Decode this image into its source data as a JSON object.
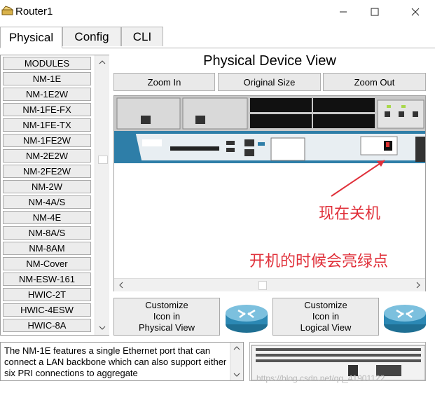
{
  "window": {
    "title": "Router1",
    "controls": {
      "minimize": "—",
      "maximize": "☐",
      "close": "✕"
    }
  },
  "tabs": [
    {
      "label": "Physical",
      "active": true
    },
    {
      "label": "Config",
      "active": false
    },
    {
      "label": "CLI",
      "active": false
    }
  ],
  "modules": {
    "header": "MODULES",
    "items": [
      "NM-1E",
      "NM-1E2W",
      "NM-1FE-FX",
      "NM-1FE-TX",
      "NM-1FE2W",
      "NM-2E2W",
      "NM-2FE2W",
      "NM-2W",
      "NM-4A/S",
      "NM-4E",
      "NM-8A/S",
      "NM-8AM",
      "NM-Cover",
      "NM-ESW-161",
      "HWIC-2T",
      "HWIC-4ESW",
      "HWIC-8A"
    ]
  },
  "device_view": {
    "title": "Physical Device View",
    "zoom_in": "Zoom In",
    "original_size": "Original Size",
    "zoom_out": "Zoom Out",
    "annotation_power_off": "现在关机",
    "annotation_power_on": "开机的时候会亮绿点"
  },
  "customize": {
    "physical": "Customize\nIcon in\nPhysical View",
    "logical": "Customize\nIcon in\nLogical View"
  },
  "description": "The NM-1E features a single Ethernet port that can connect a LAN backbone which can also support either six PRI connections to aggregate",
  "watermark": "https://blog.csdn.net/qq_41901122",
  "colors": {
    "annotation": "#e0303a",
    "router_blue": "#2e7ea8"
  }
}
